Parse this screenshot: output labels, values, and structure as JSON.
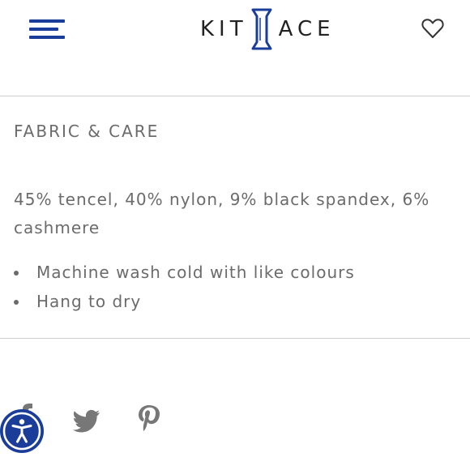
{
  "header": {
    "logo_left": "KIT",
    "logo_right": "ACE",
    "menu_icon": "hamburger-menu-icon",
    "wishlist_icon": "heart-icon",
    "accent_color": "#1a3d9a"
  },
  "section": {
    "title": "FABRIC & CARE",
    "composition": "45% tencel, 40% nylon, 9% black spandex, 6% cashmere",
    "care_items": [
      "Machine wash cold with like colours",
      "Hang to dry"
    ]
  },
  "share": {
    "icons": [
      "facebook-icon",
      "twitter-icon",
      "pinterest-icon"
    ]
  },
  "accessibility": {
    "icon": "accessibility-icon"
  }
}
